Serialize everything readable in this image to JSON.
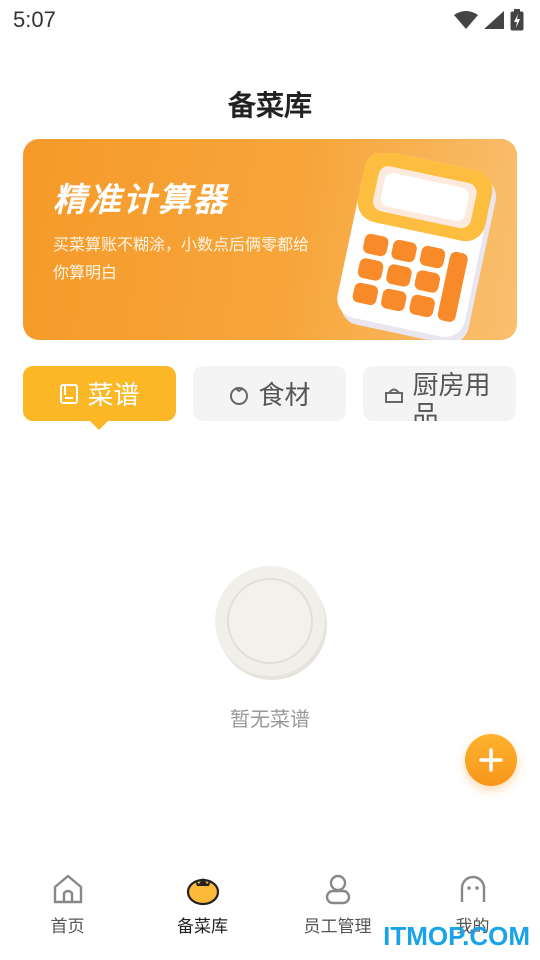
{
  "status_bar": {
    "time": "5:07"
  },
  "header": {
    "title": "备菜库"
  },
  "banner": {
    "title": "精准计算器",
    "subtitle": "买菜算账不糊涂，小数点后俩零都给你算明白"
  },
  "tabs": [
    {
      "label": "菜谱",
      "icon": "book-icon",
      "active": true
    },
    {
      "label": "食材",
      "icon": "tomato-icon",
      "active": false
    },
    {
      "label": "厨房用品",
      "icon": "pot-icon",
      "active": false
    }
  ],
  "empty_state": {
    "text": "暂无菜谱",
    "icon": "plate-icon"
  },
  "fab": {
    "icon": "plus-icon"
  },
  "bottom_nav": [
    {
      "label": "首页",
      "icon": "home-icon",
      "active": false
    },
    {
      "label": "备菜库",
      "icon": "tomato-icon",
      "active": true
    },
    {
      "label": "员工管理",
      "icon": "person-icon",
      "active": false
    },
    {
      "label": "我的",
      "icon": "face-icon",
      "active": false
    }
  ],
  "watermark": "ITMOP.COM",
  "colors": {
    "accent": "#fbb726",
    "fab": "#f7961b",
    "banner": "#f59a2a"
  }
}
